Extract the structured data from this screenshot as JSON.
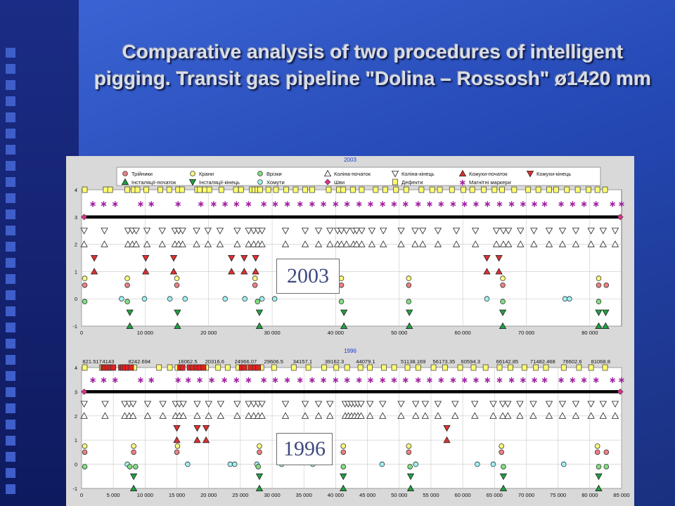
{
  "slide": {
    "title": "Comparative analysis of two procedures of intelligent pigging. Transit gas pipeline \"Dolina – Rossosh\" ø1420 mm"
  },
  "colors": {
    "background": "#2a4cc0",
    "tee": "#f08080",
    "valve": "#ffff80",
    "tapping": "#80e080",
    "bend": "#ffffff",
    "casing": "#e03030",
    "installation": "#20a040",
    "clamp": "#a0f0f0",
    "weld": "#e03090",
    "defect": "#ffff70",
    "marker": "#a020a0"
  },
  "legend": [
    {
      "label": "Трійники",
      "symbol": "circle",
      "color": "#f08080"
    },
    {
      "label": "Крани",
      "symbol": "circle",
      "color": "#ffff80"
    },
    {
      "label": "Врізки",
      "symbol": "circle",
      "color": "#80e080"
    },
    {
      "label": "Коліна-початок",
      "symbol": "triangle-up",
      "color": "#ffffff"
    },
    {
      "label": "Коліна-кінець",
      "symbol": "triangle-down",
      "color": "#ffffff"
    },
    {
      "label": "Кожухи-початок",
      "symbol": "triangle-up",
      "color": "#e03030"
    },
    {
      "label": "Кожухи-кінець",
      "symbol": "triangle-down",
      "color": "#e03030"
    },
    {
      "label": "Інсталяції-початок",
      "symbol": "triangle-up",
      "color": "#20a040"
    },
    {
      "label": "Інсталяції-кінець",
      "symbol": "triangle-down",
      "color": "#20a040"
    },
    {
      "label": "Хомути",
      "symbol": "circle",
      "color": "#a0f0f0"
    },
    {
      "label": "Шви",
      "symbol": "diamond",
      "color": "#e03090"
    },
    {
      "label": "Дефекти",
      "symbol": "square",
      "color": "#ffff70"
    },
    {
      "label": "Магнітні маркери",
      "symbol": "asterisk",
      "color": "#a020a0"
    }
  ],
  "chart_data": [
    {
      "type": "scatter",
      "title": "2003",
      "label": "2003",
      "xlim": [
        0,
        85000
      ],
      "ylim": [
        -1,
        4
      ],
      "x_ticks": [
        0,
        10000,
        20000,
        30000,
        40000,
        50000,
        60000,
        70000,
        80000
      ],
      "x_tick_labels": [
        "0",
        "10 000",
        "20 000",
        "30 000",
        "40 000",
        "50 000",
        "60 000",
        "70 000",
        "80 000"
      ],
      "y_ticks": [
        -1,
        0,
        1,
        2,
        3,
        4
      ],
      "km_labels": [],
      "rows": {
        "defects_y4": {
          "y": 4,
          "x": [
            500,
            3800,
            4500,
            7200,
            8200,
            8800,
            10200,
            12400,
            13800,
            15200,
            15800,
            18200,
            18600,
            19400,
            20100,
            22000,
            24300,
            25100,
            26800,
            27200,
            27700,
            28100,
            29400,
            30600,
            32200,
            33700,
            35200,
            36300,
            38900,
            40500,
            41200,
            42700,
            44100,
            46300,
            47800,
            49500,
            51100,
            53500,
            55200,
            56400,
            58300,
            60100,
            61500,
            63300,
            65000,
            66200,
            68100,
            70300,
            71900,
            73600,
            74700,
            76400,
            78100,
            79800,
            81200,
            82400
          ]
        },
        "magnetic_markers_y3_5": {
          "y": 3.5,
          "x": [
            1800,
            3500,
            5300,
            9300,
            11000,
            15200,
            18800,
            20800,
            22600,
            24400,
            26300,
            28700,
            30500,
            32400,
            34400,
            36300,
            38100,
            40000,
            41800,
            43700,
            45500,
            47400,
            49200,
            51000,
            53000,
            54800,
            56600,
            58500,
            60300,
            62100,
            63900,
            65800,
            67700,
            69500,
            71300,
            72900,
            75500,
            77300,
            79100,
            81000,
            83600,
            85000
          ]
        },
        "welds_y3": {
          "y": 3,
          "x": [
            400,
            84800
          ]
        },
        "bend_end_y2_5": {
          "y": 2.5,
          "x": [
            400,
            3600,
            7300,
            8000,
            8600,
            10300,
            12700,
            14700,
            15300,
            15900,
            18100,
            19900,
            21800,
            24500,
            26300,
            27100,
            27800,
            28400,
            32100,
            35200,
            37300,
            39100,
            40300,
            40900,
            41700,
            42800,
            43300,
            44100,
            45700,
            47500,
            50300,
            52500,
            53700,
            56100,
            59000,
            62000,
            65300,
            66400,
            67200,
            69100,
            71200,
            73600,
            75700,
            77800,
            80200,
            82100,
            84000
          ]
        },
        "bend_start_y2": {
          "y": 2,
          "x": [
            400,
            3600,
            7300,
            8000,
            8600,
            10300,
            12700,
            14700,
            15300,
            15900,
            18100,
            19900,
            21800,
            24500,
            26300,
            27100,
            27800,
            28400,
            32100,
            35200,
            37300,
            39100,
            40300,
            40900,
            41700,
            42800,
            43300,
            44100,
            45700,
            47500,
            50300,
            52500,
            53700,
            56100,
            59000,
            62000,
            65300,
            66400,
            67200,
            69100,
            71200,
            73600,
            75700,
            77800,
            80200,
            82100,
            84000
          ]
        },
        "casing_end_y1_5": {
          "y": 1.5,
          "x": [
            2000,
            10100,
            14500,
            23600,
            25600,
            27400,
            63800,
            65700
          ]
        },
        "casing_start_y1": {
          "y": 1,
          "x": [
            2000,
            10100,
            14500,
            23600,
            25600,
            27400,
            63800,
            65700
          ]
        },
        "valves_y0_75": {
          "y": 0.75,
          "x": [
            500,
            7200,
            15000,
            27300,
            40900,
            51500,
            66300,
            81400
          ]
        },
        "tees_y0_5": {
          "y": 0.5,
          "x": [
            500,
            7200,
            15000,
            27300,
            40900,
            51500,
            66300,
            81400,
            82600
          ]
        },
        "clamps_y0": {
          "y": 0,
          "x": [
            6300,
            9900,
            13900,
            16300,
            22600,
            25700,
            28400,
            30400,
            63800,
            76100,
            76800
          ]
        },
        "tappings_y_0": {
          "y": -0.1,
          "x": [
            500,
            7200,
            27700,
            40900,
            51500,
            66300,
            81400
          ]
        },
        "installation_end_y_0_5": {
          "y": -0.5,
          "x": [
            7600,
            15100,
            28000,
            41300,
            51600,
            66300,
            81400,
            82500
          ]
        },
        "installation_start_y_1": {
          "y": -1,
          "x": [
            7600,
            15100,
            28000,
            41300,
            51600,
            66300,
            81400,
            82500
          ]
        }
      }
    },
    {
      "type": "scatter",
      "title": "1996",
      "label": "1996",
      "xlim": [
        0,
        85000
      ],
      "ylim": [
        -1,
        4
      ],
      "x_ticks": [
        0,
        5000,
        10000,
        15000,
        20000,
        25000,
        30000,
        35000,
        40000,
        45000,
        50000,
        55000,
        60000,
        65000,
        70000,
        75000,
        80000,
        85000
      ],
      "x_tick_labels": [
        "0",
        "5 000",
        "10 000",
        "15 000",
        "20 000",
        "25 000",
        "30 000",
        "35 000",
        "40 000",
        "45 000",
        "50 000",
        "55 000",
        "60 000",
        "65 000",
        "70 000",
        "75 000",
        "80 000",
        "85 000"
      ],
      "y_ticks": [
        -1,
        0,
        1,
        2,
        3,
        4
      ],
      "km_labels": [
        "821.517",
        "4143",
        "8242.694",
        "16062.5",
        "20316.6",
        "24966.07",
        "29606.5",
        "34157.1",
        "39162.3",
        "44079.1",
        "51138.169",
        "56173.35",
        "60594.3",
        "66142.85",
        "71482.468",
        "76602.6",
        "81068.8"
      ],
      "km_label_positions": [
        821.517,
        4143,
        8242.694,
        16062.5,
        20316.6,
        24966.07,
        29606.5,
        34157.1,
        39162.3,
        44079.1,
        51138.169,
        56173.35,
        60594.3,
        66142.85,
        71482.468,
        76602.6,
        81068.8
      ],
      "rows": {
        "defects_y4": {
          "y": 4,
          "x": [
            500,
            3200,
            4200,
            7100,
            8300,
            12200,
            13900,
            15100,
            15900,
            18500,
            19600,
            21500,
            23000,
            24700,
            26400,
            27500,
            28300,
            30300,
            33400,
            35700,
            38200,
            40100,
            41800,
            43900,
            45400,
            47600,
            49200,
            51300,
            53000,
            55400,
            57200,
            59600,
            61700,
            63600,
            65800,
            67500,
            69700,
            71500,
            73100,
            75900,
            78300,
            80200,
            82400
          ]
        },
        "defects_red_y4": {
          "y": 4,
          "x": [
            3400,
            3700,
            4100,
            4600,
            5000,
            6200,
            6500,
            6900,
            7300,
            7800,
            15500,
            15900,
            17000,
            17500,
            18100,
            18600,
            19200,
            25200,
            25600,
            26600,
            27300,
            27800
          ]
        },
        "magnetic_markers_y3_5": {
          "y": 3.5,
          "x": [
            1800,
            3500,
            5300,
            9300,
            11000,
            15200,
            16800,
            18600,
            20500,
            22500,
            24400,
            26300,
            28700,
            30500,
            32400,
            34400,
            36300,
            38100,
            40000,
            41800,
            43700,
            45500,
            47400,
            49200,
            51000,
            53000,
            54800,
            56600,
            58500,
            60300,
            62100,
            63900,
            65800,
            67700,
            69500,
            71300,
            72900,
            75500,
            77300,
            79100,
            81000,
            83600,
            85000
          ]
        },
        "welds_y3": {
          "y": 3,
          "x": [
            400,
            84800
          ]
        },
        "bend_end_y2_5": {
          "y": 2.5,
          "x": [
            400,
            3700,
            6800,
            7500,
            8100,
            10400,
            12800,
            14800,
            15400,
            16000,
            18200,
            20000,
            21900,
            24500,
            26300,
            27100,
            27800,
            28400,
            32100,
            35200,
            37300,
            39100,
            41500,
            42000,
            42500,
            43000,
            43500,
            44000,
            45400,
            47400,
            50300,
            52600,
            54100,
            56100,
            58800,
            61900,
            64800,
            66300,
            67100,
            69000,
            71100,
            73600,
            75700,
            77800,
            80200,
            82100,
            84000
          ]
        },
        "bend_start_y2": {
          "y": 2,
          "x": [
            400,
            3700,
            6800,
            7500,
            8100,
            10400,
            12800,
            14800,
            15400,
            16000,
            18200,
            20000,
            21900,
            24500,
            26300,
            27100,
            27800,
            28400,
            32100,
            35200,
            37300,
            39100,
            41500,
            42000,
            42500,
            43000,
            43500,
            44000,
            45400,
            47400,
            50300,
            52600,
            54100,
            56100,
            58800,
            61900,
            64800,
            66300,
            67100,
            69000,
            71100,
            73600,
            75700,
            77800,
            80200,
            82100,
            84000
          ]
        },
        "casing_end_y1_5": {
          "y": 1.5,
          "x": [
            15000,
            18200,
            19600,
            57500
          ]
        },
        "casing_start_y1": {
          "y": 1,
          "x": [
            15000,
            18200,
            19600,
            57500
          ]
        },
        "valves_y0_75": {
          "y": 0.75,
          "x": [
            500,
            8200,
            15100,
            28000,
            41200,
            51500,
            66100,
            81200
          ]
        },
        "tees_y0_5": {
          "y": 0.5,
          "x": [
            500,
            8200,
            15000,
            28000,
            41200,
            51500,
            66100,
            81200,
            82600
          ]
        },
        "clamps_y0": {
          "y": 0,
          "x": [
            7200,
            16700,
            23400,
            24100,
            27600,
            31500,
            36400,
            47300,
            52600,
            62300,
            64800,
            75900
          ]
        },
        "tappings_y_0": {
          "y": -0.1,
          "x": [
            500,
            7600,
            8500,
            27800,
            41200,
            51700,
            66400,
            81400,
            82600
          ]
        },
        "installation_end_y_0_5": {
          "y": -0.5,
          "x": [
            8200,
            28000,
            41200,
            51800,
            66400,
            81400
          ]
        },
        "installation_start_y_1": {
          "y": -1,
          "x": [
            8200,
            28000,
            41200,
            51800,
            66400,
            81400
          ]
        }
      }
    }
  ]
}
